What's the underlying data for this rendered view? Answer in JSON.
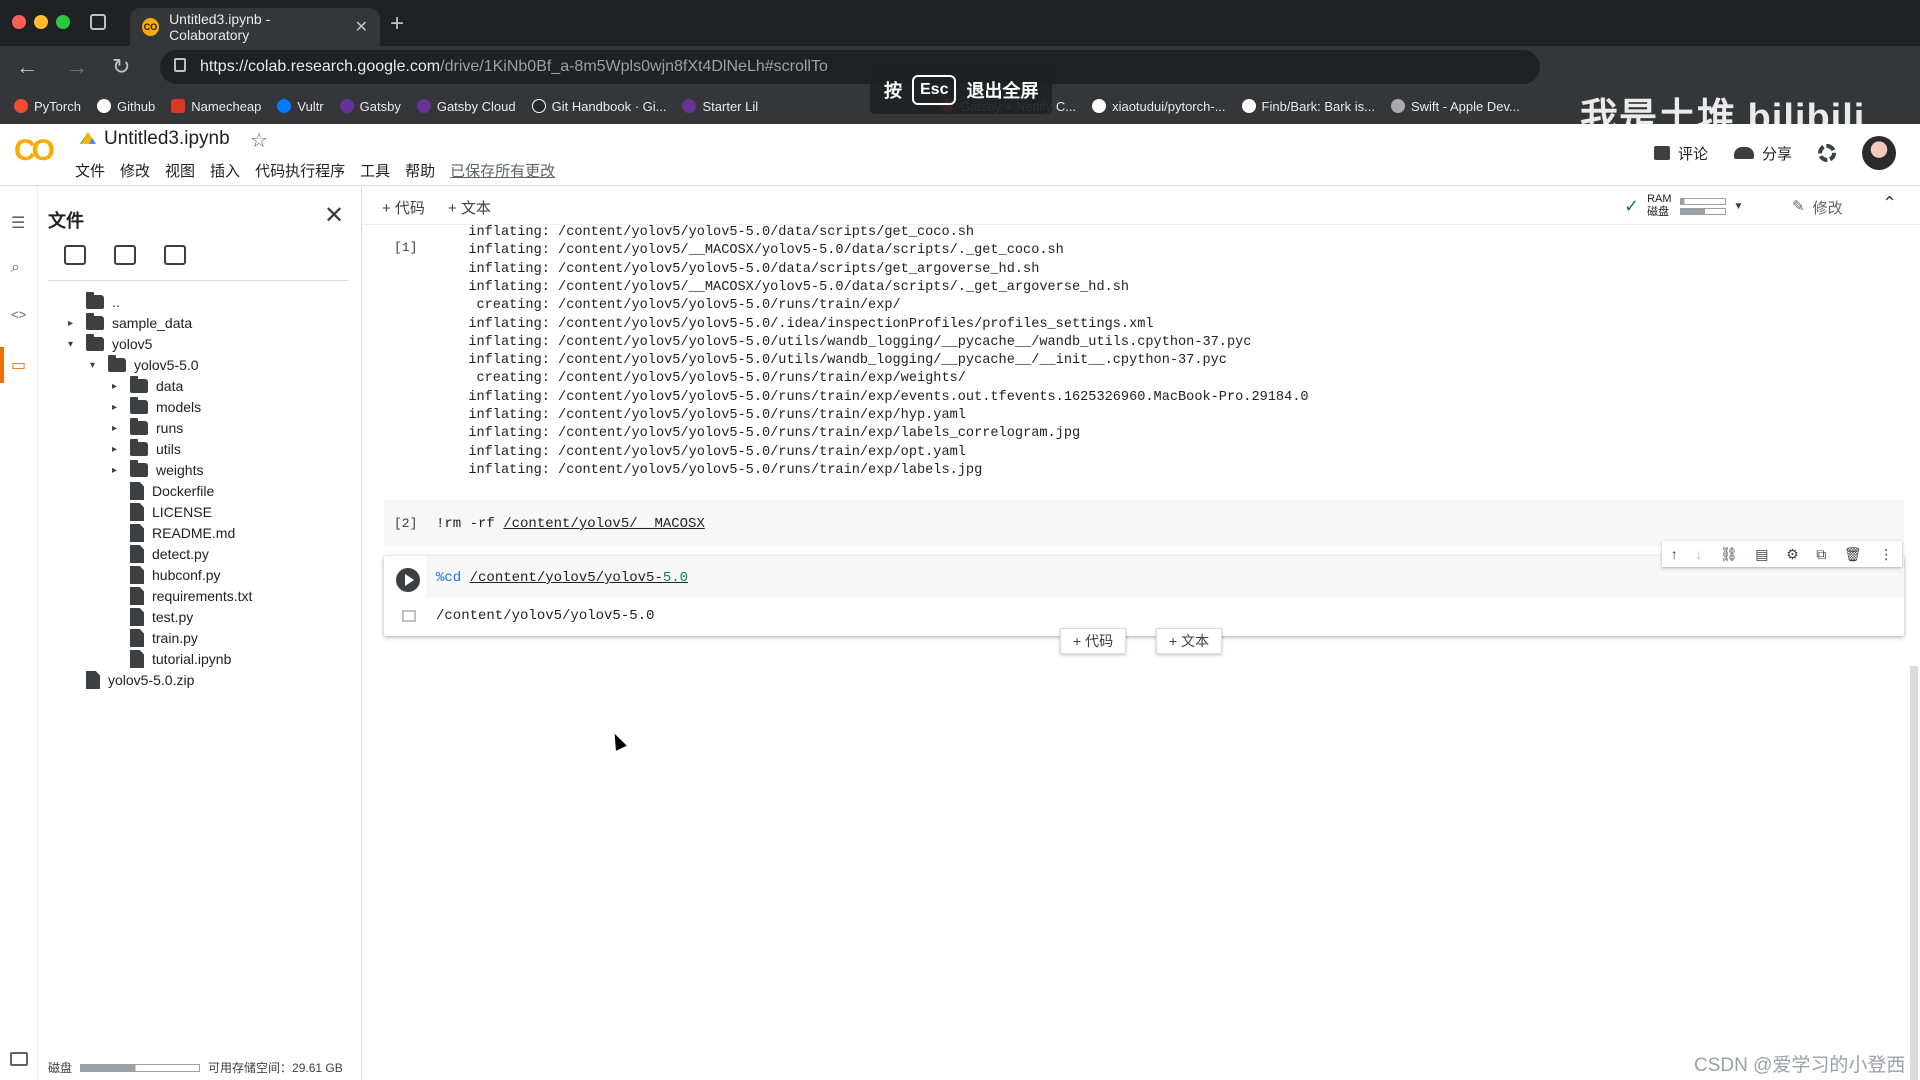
{
  "browser": {
    "tab_title": "Untitled3.ipynb - Colaboratory",
    "tab_favicon": "CO",
    "url_host": "https://colab.research.google.com",
    "url_path": "/drive/1KiNb0Bf_a-8m5Wpls0wjn8fXt4DlNeLh#scrollTo",
    "bookmarks": [
      "PyTorch",
      "Github",
      "Namecheap",
      "Vultr",
      "Gatsby",
      "Gatsby Cloud",
      "Git Handbook · Gi...",
      "Starter Lil",
      "Gatsby + Netlify C...",
      "xiaotudui/pytorch-...",
      "Finb/Bark: Bark is...",
      "Swift - Apple Dev..."
    ],
    "fullscreen_hint": {
      "pre": "按",
      "key": "Esc",
      "post": "退出全屏"
    },
    "overlay_watermark": "我是土堆  bilibili"
  },
  "header": {
    "logo": "CO",
    "title": "Untitled3.ipynb",
    "menu": [
      "文件",
      "修改",
      "视图",
      "插入",
      "代码执行程序",
      "工具",
      "帮助"
    ],
    "saved_status": "已保存所有更改",
    "comment_label": "评论",
    "share_label": "分享"
  },
  "files_panel": {
    "title": "文件",
    "tree": [
      {
        "label": "..",
        "type": "up"
      },
      {
        "label": "sample_data",
        "type": "folder",
        "caret": "▸"
      },
      {
        "label": "yolov5",
        "type": "folder",
        "caret": "▾"
      },
      {
        "label": "yolov5-5.0",
        "type": "folder",
        "caret": "▾"
      },
      {
        "label": "data",
        "type": "folder",
        "caret": "▸"
      },
      {
        "label": "models",
        "type": "folder",
        "caret": "▸"
      },
      {
        "label": "runs",
        "type": "folder",
        "caret": "▸"
      },
      {
        "label": "utils",
        "type": "folder",
        "caret": "▸"
      },
      {
        "label": "weights",
        "type": "folder",
        "caret": "▸"
      },
      {
        "label": "Dockerfile",
        "type": "file"
      },
      {
        "label": "LICENSE",
        "type": "file"
      },
      {
        "label": "README.md",
        "type": "file"
      },
      {
        "label": "detect.py",
        "type": "file"
      },
      {
        "label": "hubconf.py",
        "type": "file"
      },
      {
        "label": "requirements.txt",
        "type": "file"
      },
      {
        "label": "test.py",
        "type": "file"
      },
      {
        "label": "train.py",
        "type": "file"
      },
      {
        "label": "tutorial.ipynb",
        "type": "file"
      },
      {
        "label": "yolov5-5.0.zip",
        "type": "file"
      }
    ],
    "disk_label": "磁盘",
    "disk_usage_fraction": 0.46,
    "disk_free": "可用存储空间：29.61 GB"
  },
  "notebook_toolbar": {
    "add_code": "+ 代码",
    "add_text": "+ 文本",
    "ram_label": "RAM",
    "disk_label": "磁盘",
    "edit_label": "修改"
  },
  "cells": {
    "cell1_exec": "[1]",
    "cell1_output": [
      "  inflating: /content/yolov5/yolov5-5.0/data/scripts/get_coco.sh",
      "  inflating: /content/yolov5/__MACOSX/yolov5-5.0/data/scripts/._get_coco.sh",
      "  inflating: /content/yolov5/yolov5-5.0/data/scripts/get_argoverse_hd.sh",
      "  inflating: /content/yolov5/__MACOSX/yolov5-5.0/data/scripts/._get_argoverse_hd.sh",
      "   creating: /content/yolov5/yolov5-5.0/runs/train/exp/",
      "  inflating: /content/yolov5/yolov5-5.0/.idea/inspectionProfiles/profiles_settings.xml",
      "  inflating: /content/yolov5/yolov5-5.0/utils/wandb_logging/__pycache__/wandb_utils.cpython-37.pyc",
      "  inflating: /content/yolov5/yolov5-5.0/utils/wandb_logging/__pycache__/__init__.cpython-37.pyc",
      "   creating: /content/yolov5/yolov5-5.0/runs/train/exp/weights/",
      "  inflating: /content/yolov5/yolov5-5.0/runs/train/exp/events.out.tfevents.1625326960.MacBook-Pro.29184.0",
      "  inflating: /content/yolov5/yolov5-5.0/runs/train/exp/hyp.yaml",
      "  inflating: /content/yolov5/yolov5-5.0/runs/train/exp/labels_correlogram.jpg",
      "  inflating: /content/yolov5/yolov5-5.0/runs/train/exp/opt.yaml",
      "  inflating: /content/yolov5/yolov5-5.0/runs/train/exp/labels.jpg"
    ],
    "cell2_exec": "[2]",
    "cell2_cmd": "!rm -rf ",
    "cell2_path": "/content/yolov5/__MACOSX",
    "cell3_magic": "%cd ",
    "cell3_path": "/content/yolov5/yolov5-",
    "cell3_num": "5.0",
    "cell3_output": "/content/yolov5/yolov5-5.0"
  },
  "inline_add": {
    "code": "+ 代码",
    "text": "+ 文本"
  },
  "footer_watermark": "CSDN @爱学习的小登西"
}
